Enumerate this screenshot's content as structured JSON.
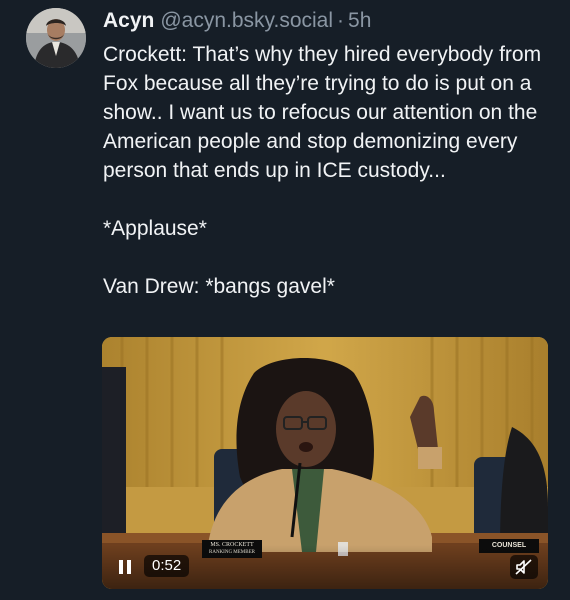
{
  "post": {
    "author_name": "Acyn",
    "handle": "@acyn.bsky.social",
    "separator": "·",
    "time": "5h",
    "paragraphs": [
      "Crockett: That’s why they hired everybody from Fox because all they’re trying to do is put on a show.. I want us to refocus our attention on the American people and stop demonizing every person that ends up in ICE custody...",
      "*Applause*",
      "Van Drew: *bangs gavel*"
    ]
  },
  "video": {
    "timestamp": "0:52",
    "nameplate_line1": "MS. CROCKETT",
    "nameplate_line2": "RANKING MEMBER",
    "counsel_label": "COUNSEL",
    "play_state_icon": "pause-icon",
    "mute_icon": "muted-speaker-icon"
  },
  "colors": {
    "background": "#161e27",
    "text": "#f1f3f5",
    "muted_text": "#8a96a3"
  }
}
